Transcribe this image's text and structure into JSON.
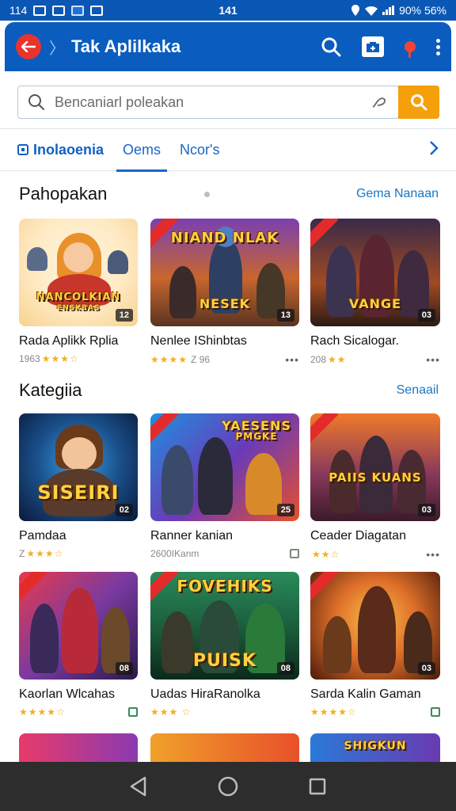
{
  "status_bar": {
    "left_text": "114",
    "clock": "141",
    "battery_text": "90% 56%"
  },
  "app_bar": {
    "title": "Tak Aplilkaka",
    "icons": [
      "back-arrow-icon",
      "search-icon",
      "store-icon",
      "location-pin-icon",
      "kebab-menu-icon"
    ]
  },
  "search": {
    "placeholder": "Bencaniarl poleakan"
  },
  "tabs": [
    {
      "label": "Inolaoenia",
      "active": false
    },
    {
      "label": "Oems",
      "active": true
    },
    {
      "label": "Ncor's",
      "active": false
    }
  ],
  "section_featured": {
    "title": "Pahopakan",
    "link": "Gema Nanaan"
  },
  "featured": [
    {
      "name": "Rada Aplikk Rplia",
      "meta": "1963",
      "rating": 3,
      "art": "NANCOLKIAN",
      "art_sub": "ENSKBAS",
      "badge": "12"
    },
    {
      "name": "Nenlee IShinbtas",
      "meta": "Z 96",
      "rating": 4,
      "art": "NIAND NLAK",
      "art_sub": "NESEK",
      "badge": "13"
    },
    {
      "name": "Rach Sicalogar.",
      "meta": "208",
      "rating": 2,
      "art": "VANGE",
      "art_sub": "",
      "badge": "03"
    }
  ],
  "section_category": {
    "title": "Kategiia",
    "link": "Senaail"
  },
  "category": [
    {
      "name": "Pamdaa",
      "meta": "Z",
      "rating": 3,
      "art": "SISEIRI",
      "art_sub": "",
      "badge": "02"
    },
    {
      "name": "Ranner kanian",
      "meta": "2600IKanm",
      "rating": 0,
      "art": "YAESENS",
      "art_sub": "PMGKE",
      "badge": "25"
    },
    {
      "name": "Ceader Diagatan",
      "meta": "",
      "rating": 2,
      "art": "PAIIS KUANS",
      "art_sub": "",
      "badge": "03"
    },
    {
      "name": "Kaorlan Wlcahas",
      "meta": "",
      "rating": 4,
      "art": "",
      "art_sub": "",
      "badge": "08"
    },
    {
      "name": "Uadas HiraRanolka",
      "meta": "",
      "rating": 3,
      "art": "FOVEHIKS",
      "art_sub": "PUISK",
      "badge": "08"
    },
    {
      "name": "Sarda Kalin Gaman",
      "meta": "",
      "rating": 4,
      "art": "",
      "art_sub": "",
      "badge": "03"
    }
  ],
  "peek_row": [
    {
      "art": ""
    },
    {
      "art": ""
    },
    {
      "art": "SHIGKUN"
    }
  ],
  "nav_bar": {
    "icons": [
      "back-triangle-icon",
      "home-circle-icon",
      "recents-square-icon"
    ]
  }
}
